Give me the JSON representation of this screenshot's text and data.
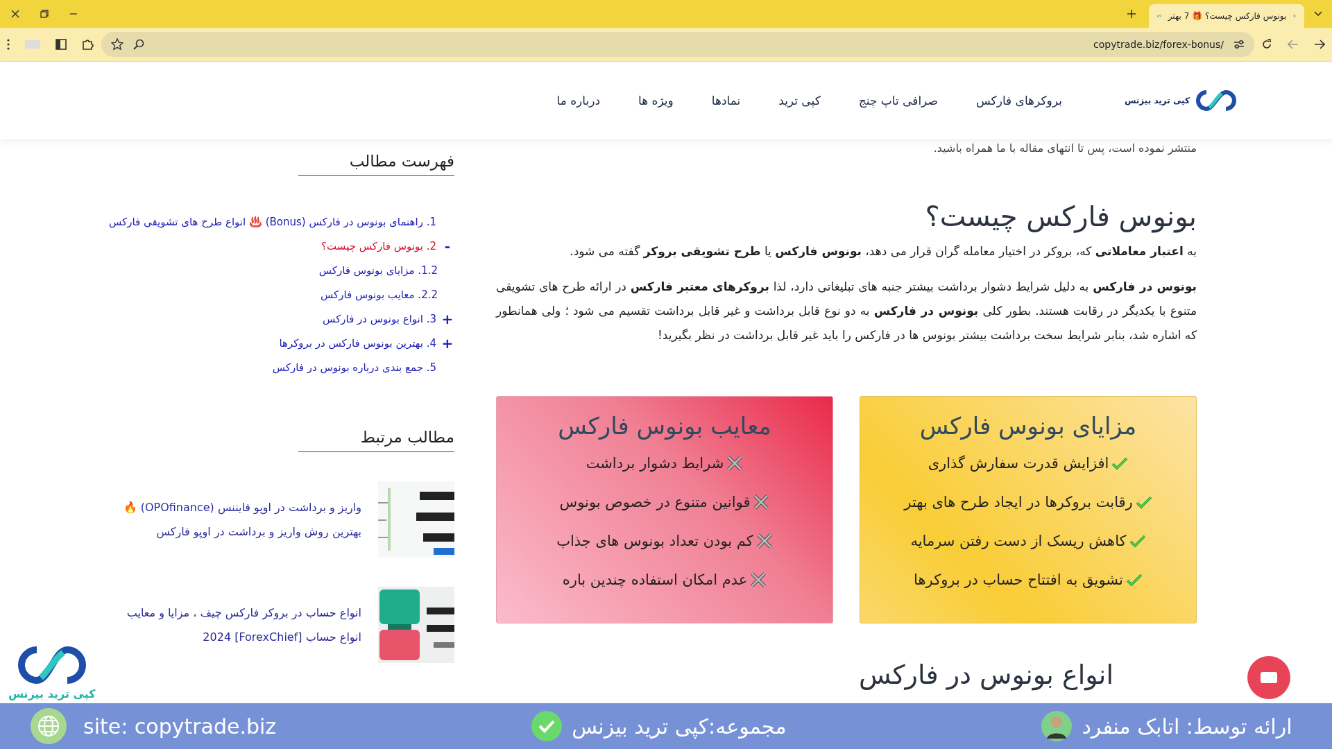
{
  "browser": {
    "tab_title": "بونوس فارکس چیست؟ 🎁 7 بهتر",
    "url": "copytrade.biz/forex-bonus/"
  },
  "nav": {
    "logo_text": "کپی ترید بیزنس",
    "items": [
      "بروکرهای فارکس",
      "صرافی تاپ چنج",
      "کپی ترید",
      "نمادها",
      "ویژه ها",
      "درباره ما"
    ]
  },
  "article": {
    "intro_cut": "منتشر نموده است، پس تا انتهای مقاله با ما همراه باشید.",
    "heading": "بونوس فارکس چیست؟",
    "paragraphs": [
      "به **اعتبار معاملاتی** که، بروکر در اختیار معامله گران قرار می دهد، **بونوس فارکس** یا **طرح تشویقی بروکر** گفته می شود.",
      "**بونوس در فارکس** به دلیل شرایط دشوار برداشت بیشتر جنبه های تبلیغاتی دارد، لذا **بروکرهای معتبر فارکس** در ارائه طرح های تشویقی متنوع با یکدیگر در رقابت هستند.  بطور کلی **بونوس در فارکس** به دو نوع قابل برداشت و غیر قابل برداشت تقسیم می شود ؛ ولی همانطور که اشاره شد، بنابر شرایط سخت برداشت بیشتر بونوس ها در فارکس را باید غیر قابل برداشت در نظر بگیرید!"
    ],
    "cards": [
      {
        "kind": "pros",
        "title": "مزایای بونوس فارکس",
        "items": [
          "افزایش قدرت سفارش گذاری",
          "رقابت بروکرها در ایجاد طرح های بهتر",
          "کاهش ریسک از دست رفتن سرمایه",
          "تشویق به افتتاح حساب در بروکرها"
        ]
      },
      {
        "kind": "cons",
        "title": "معایب بونوس فارکس",
        "items": [
          "شرایط دشوار برداشت",
          "قوانین متنوع در خصوص بونوس",
          "کم بودن تعداد بونوس های جذاب",
          "عدم امکان استفاده چندین باره"
        ]
      }
    ],
    "next_heading": "انواع بونوس در فارکس"
  },
  "sidebar": {
    "toc_title": "فهرست مطالب",
    "toc": [
      {
        "number": "1.",
        "text": "راهنمای بونوس در فارکس (Bonus) ♨️ انواع طرح های تشویقی فارکس",
        "selected": false
      },
      {
        "number": "2.",
        "text": "بونوس فارکس چیست؟",
        "selected": true,
        "toggle": "-",
        "children": [
          {
            "number": "1.2.",
            "text": "مزایای بونوس فارکس",
            "selected": false
          },
          {
            "number": "2.2.",
            "text": "معایب بونوس فارکس",
            "selected": false
          }
        ]
      },
      {
        "number": "3.",
        "text": "انواع بونوس در فارکس",
        "selected": false,
        "toggle": "+"
      },
      {
        "number": "4.",
        "text": "بهترین بونوس فارکس در بروکرها",
        "selected": false,
        "toggle": "+"
      },
      {
        "number": "5.",
        "text": "جمع بندی درباره بونوس در فارکس",
        "selected": false
      }
    ],
    "related_title": "مطالب مرتبط",
    "related": [
      {
        "title": "واریز و برداشت در اوپو فایننس (OPOfinance) 🔥 بهترین روش واریز و برداشت در اوپو فارکس"
      },
      {
        "title": "انواع حساب در بروکر فارکس چیف ، مزایا و معایب انواع حساب [ForexChief] 2024"
      }
    ]
  },
  "overlay": {
    "logo_text": "کپی ترید بیزنس",
    "site": "site: copytrade.biz",
    "collection": "مجموعه:کپی ترید بیزنس",
    "presenter": "ارائه توسط: اتابک منفرد"
  }
}
